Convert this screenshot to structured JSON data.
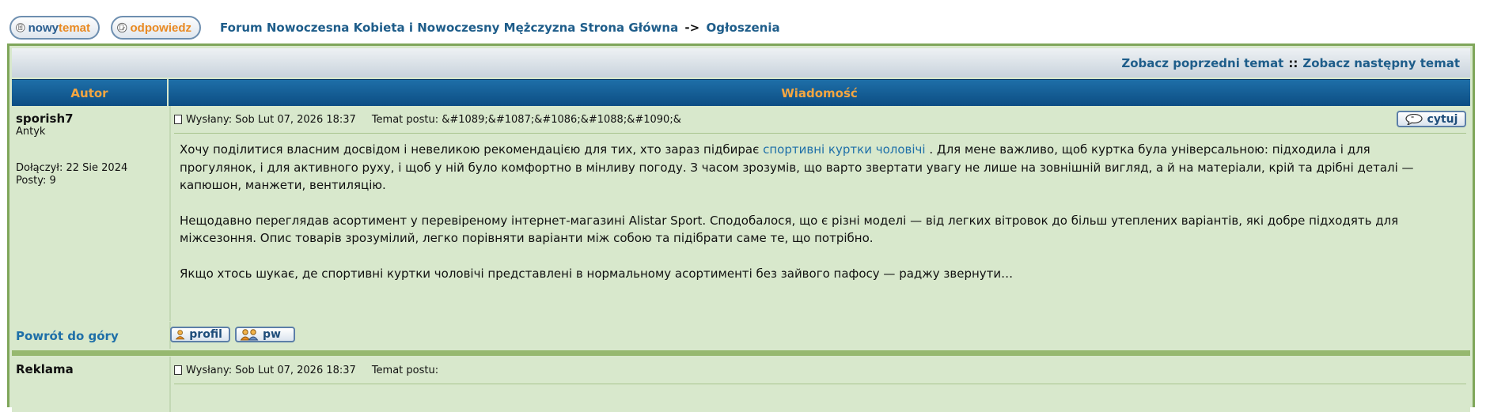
{
  "toolbar": {
    "new_topic": {
      "word1": "nowy",
      "word2": "temat"
    },
    "reply": {
      "word1": "odpowiedz"
    },
    "breadcrumb": {
      "forum": "Forum Nowoczesna Kobieta i Nowoczesny Mężczyzna Strona Główna",
      "separator": "->",
      "section": "Ogłoszenia"
    }
  },
  "prevnext": {
    "prev": "Zobacz poprzedni temat",
    "separator": "::",
    "next": "Zobacz następny temat"
  },
  "table": {
    "col_author": "Autor",
    "col_message": "Wiadomość"
  },
  "posts": [
    {
      "author": "sporish7",
      "rank": "Antyk",
      "joined": "Dołączył: 22 Sie 2024",
      "posts": "Posty: 9",
      "sent": "Wysłany: Sob Lut 07, 2026 18:37",
      "subject": "Temat postu: &#1089;&#1087;&#1086;&#1088;&#1090;&",
      "quote_label": "cytuj",
      "p1_before": "Хочу поділитися власним досвідом і невеликою рекомендацією для тих, хто зараз підбирає ",
      "p1_link": "спортивні куртки чоловічі",
      "p1_after": " . Для мене важливо, щоб куртка була універсальною: підходила і для прогулянок, і для активного руху, і щоб у ній було комфортно в мінливу погоду. З часом зрозумів, що варто звертати увагу не лише на зовнішній вигляд, а й на матеріали, крій та дрібні деталі — капюшон, манжети, вентиляцію.",
      "p2": "Нещодавно переглядав асортимент у перевіреному інтернет-магазині Alistar Sport. Сподобалося, що є різні моделі — від легких вітровок до більш утеплених варіантів, які добре підходять для міжсезоння. Опис товарів зрозумілий, легко порівняти варіанти між собою та підібрати саме те, що потрібно.",
      "p3": "Якщо хтось шукає, де спортивні куртки чоловічі представлені в нормальному асортименті без зайвого пафосу — раджу звернути…",
      "back_to_top": "Powrót do góry",
      "profile_label": "profil",
      "pm_label": "pw"
    },
    {
      "author": "Reklama",
      "sent": "Wysłany: Sob Lut 07, 2026 18:37",
      "subject": "Temat postu:"
    }
  ],
  "colors": {
    "accent_blue": "#1e5d8a",
    "header_orange": "#f4a641",
    "row_green": "#d8e8cc",
    "frame_green": "#7fa65a"
  }
}
